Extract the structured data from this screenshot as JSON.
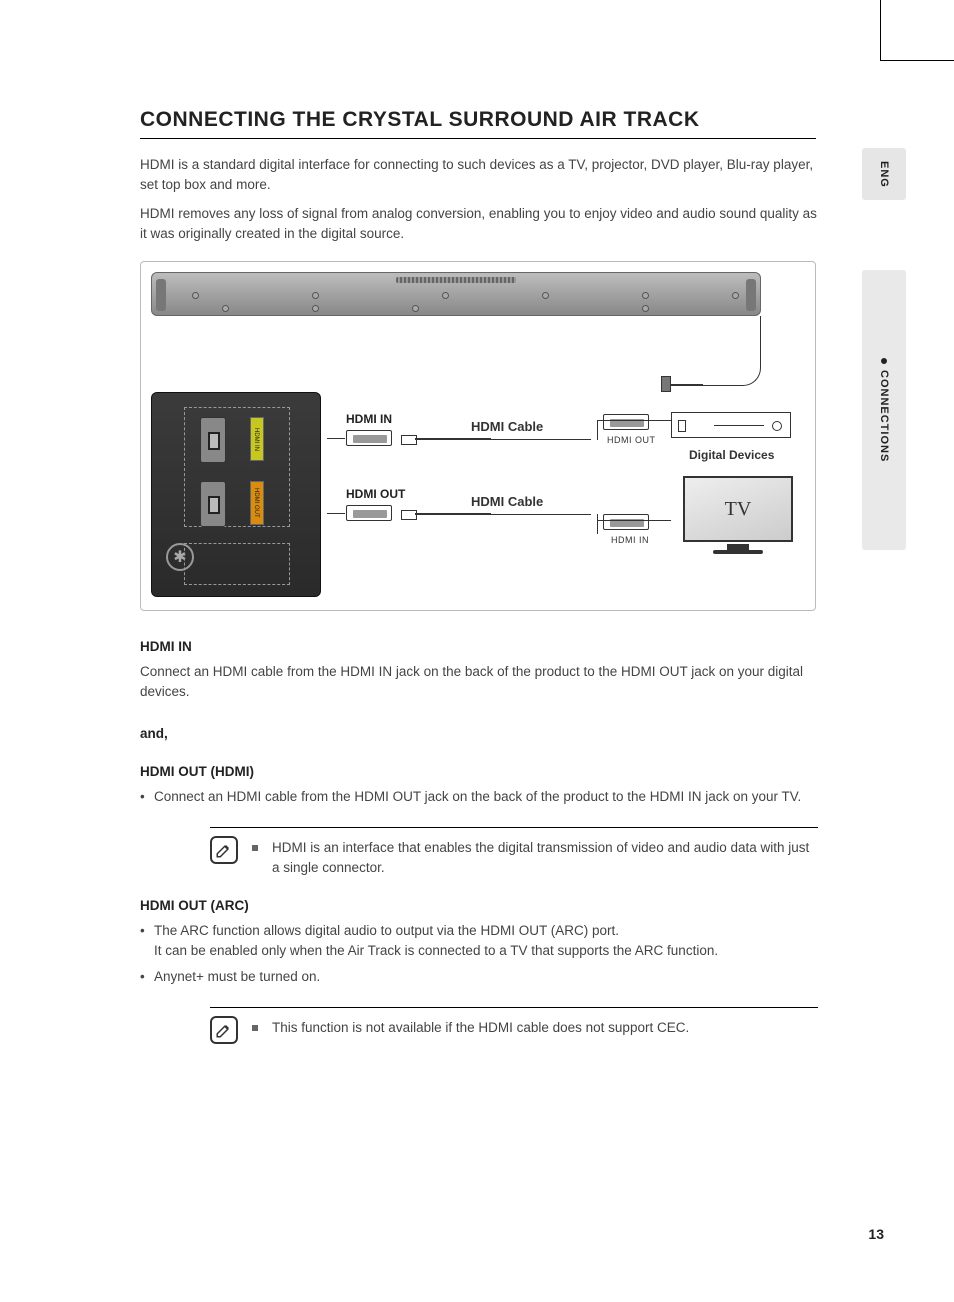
{
  "sideTabs": {
    "lang": "ENG",
    "section": "CONNECTIONS"
  },
  "title": "CONNECTING THE CRYSTAL SURROUND AIR TRACK",
  "intro": {
    "p1": "HDMI is a standard digital interface for connecting to such devices as a TV, projector, DVD player, Blu-ray player, set top box and more.",
    "p2": "HDMI removes any loss of signal from analog conversion, enabling you to enjoy video and audio sound quality as it was originally created in the digital source."
  },
  "diagram": {
    "hdmiInLabel": "HDMI IN",
    "hdmiOutLabel": "HDMI OUT",
    "cableLabel": "HDMI Cable",
    "digDevHdmiOut": "HDMI OUT",
    "tvHdmiIn": "HDMI IN",
    "digitalDevices": "Digital Devices",
    "tvText": "TV"
  },
  "sections": {
    "hdmiIn": {
      "heading": "HDMI IN",
      "text": "Connect an HDMI cable from the HDMI IN jack on the back of the product to the HDMI OUT jack on your digital devices."
    },
    "and": "and,",
    "hdmiOut": {
      "heading": "HDMI OUT (HDMI)",
      "bullet": "Connect an HDMI cable from the HDMI OUT jack on the back of the product to the HDMI IN jack on your TV."
    },
    "note1": "HDMI is an interface that enables the digital transmission of video and audio data with just a single connector.",
    "hdmiArc": {
      "heading": "HDMI OUT (ARC)",
      "b1a": "The ARC function allows digital audio to output via the HDMI OUT (ARC) port.",
      "b1b": "It can be enabled only when the Air Track is connected to a TV that supports the ARC function.",
      "b2": "Anynet+ must be turned on."
    },
    "note2": "This function is not available if the HDMI cable does not support CEC."
  },
  "pageNumber": "13"
}
